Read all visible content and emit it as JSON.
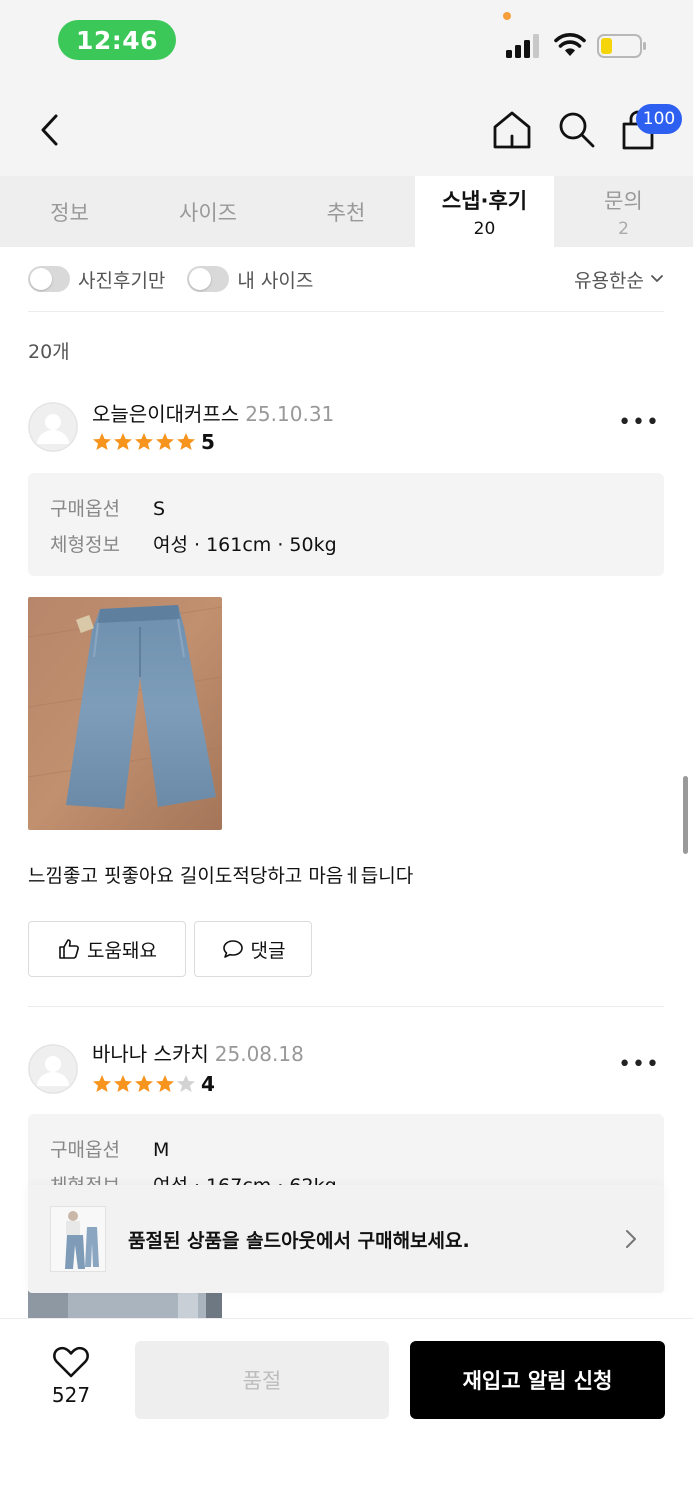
{
  "status_bar": {
    "time": "12:46"
  },
  "nav": {
    "cart_count": "100"
  },
  "tabs": [
    {
      "label": "정보",
      "count": ""
    },
    {
      "label": "사이즈",
      "count": ""
    },
    {
      "label": "추천",
      "count": ""
    },
    {
      "label": "스냅·후기",
      "count": "20",
      "active": true
    },
    {
      "label": "문의",
      "count": "2"
    }
  ],
  "filters": {
    "photo_only": "사진후기만",
    "my_size": "내 사이즈",
    "sort": "유용한순"
  },
  "review_count": "20개",
  "reviews": [
    {
      "name": "오늘은이대커프스",
      "date": "25.10.31",
      "rating": "5",
      "rating_value": 5,
      "option_key": "구매옵션",
      "option_value": "S",
      "body_key": "체형정보",
      "body_value": "여성 · 161cm · 50kg",
      "text": "느낌좋고 핏좋아요 길이도적당하고 마음ㅔ듭니다",
      "helpful_label": "도움돼요",
      "comment_label": "댓글"
    },
    {
      "name": "바나나 스카치",
      "date": "25.08.18",
      "rating": "4",
      "rating_value": 4,
      "option_key": "구매옵션",
      "option_value": "M",
      "body_key": "체형정보",
      "body_value": "여성 · 167cm · 62kg"
    }
  ],
  "banner": {
    "text": "품절된 상품을 솔드아웃에서 구매해보세요."
  },
  "bottom": {
    "like_count": "527",
    "soldout_label": "품절",
    "restock_label": "재입고 알림 신청"
  },
  "colors": {
    "time_pill": "#3cc859",
    "star": "#f7941d",
    "badge": "#2d60f0",
    "primary_button": "#000000"
  }
}
